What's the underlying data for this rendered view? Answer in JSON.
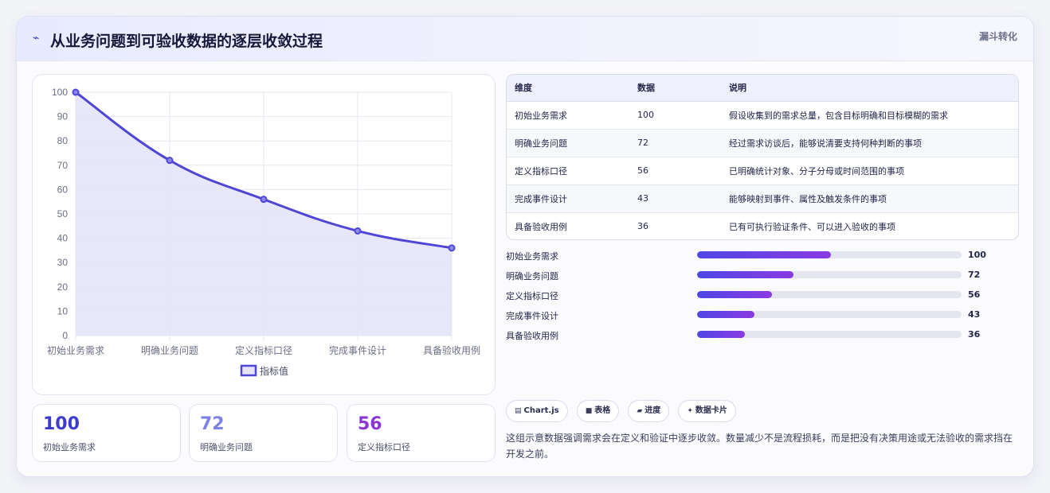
{
  "header": {
    "icon": "lightning-icon",
    "title": "从业务问题到可验收数据的逐层收敛过程",
    "tag": "漏斗转化"
  },
  "chart_data": {
    "type": "line",
    "categories": [
      "初始业务需求",
      "明确业务问题",
      "定义指标口径",
      "完成事件设计",
      "具备验收用例"
    ],
    "series": [
      {
        "name": "指标值",
        "values": [
          100,
          72,
          56,
          43,
          36
        ]
      }
    ],
    "ylim": [
      0,
      100
    ],
    "yticks": [
      0,
      10,
      20,
      30,
      40,
      50,
      60,
      70,
      80,
      90,
      100
    ],
    "fill": true,
    "grid": true,
    "legend": "bottom",
    "colors": {
      "line": "#4f46d6",
      "fill": "#e4e3f8",
      "grid": "#e6e7ef",
      "axis_text": "#6b6e85"
    }
  },
  "stats": [
    {
      "value": "100",
      "label": "初始业务需求",
      "color": "#3d3ccf"
    },
    {
      "value": "72",
      "label": "明确业务问题",
      "color": "#7d82e6"
    },
    {
      "value": "56",
      "label": "定义指标口径",
      "color": "#8a35d6"
    }
  ],
  "table": {
    "headers": [
      "维度",
      "数据",
      "说明"
    ],
    "rows": [
      [
        "初始业务需求",
        "100",
        "假设收集到的需求总量，包含目标明确和目标模糊的需求"
      ],
      [
        "明确业务问题",
        "72",
        "经过需求访谈后，能够说清要支持何种判断的事项"
      ],
      [
        "定义指标口径",
        "56",
        "已明确统计对象、分子分母或时间范围的事项"
      ],
      [
        "完成事件设计",
        "43",
        "能够映射到事件、属性及触发条件的事项"
      ],
      [
        "具备验收用例",
        "36",
        "已有可执行验证条件、可以进入验收的事项"
      ]
    ]
  },
  "progress": [
    {
      "label": "初始业务需求",
      "value": "100",
      "percent": 50.6
    },
    {
      "label": "明确业务问题",
      "value": "72",
      "percent": 36.4
    },
    {
      "label": "定义指标口径",
      "value": "56",
      "percent": 28.3
    },
    {
      "label": "完成事件设计",
      "value": "43",
      "percent": 21.7
    },
    {
      "label": "具备验收用例",
      "value": "36",
      "percent": 18.2
    }
  ],
  "chips": [
    {
      "icon": "chart-icon",
      "glyph": "▤",
      "label": "Chart.js"
    },
    {
      "icon": "table-icon",
      "glyph": "■",
      "label": "表格"
    },
    {
      "icon": "progress-icon",
      "glyph": "▰",
      "label": "进度"
    },
    {
      "icon": "card-icon",
      "glyph": "✦",
      "label": "数据卡片"
    }
  ],
  "note": "这组示意数据强调需求会在定义和验证中逐步收敛。数量减少不是流程损耗，而是把没有决策用途或无法验收的需求挡在开发之前。"
}
